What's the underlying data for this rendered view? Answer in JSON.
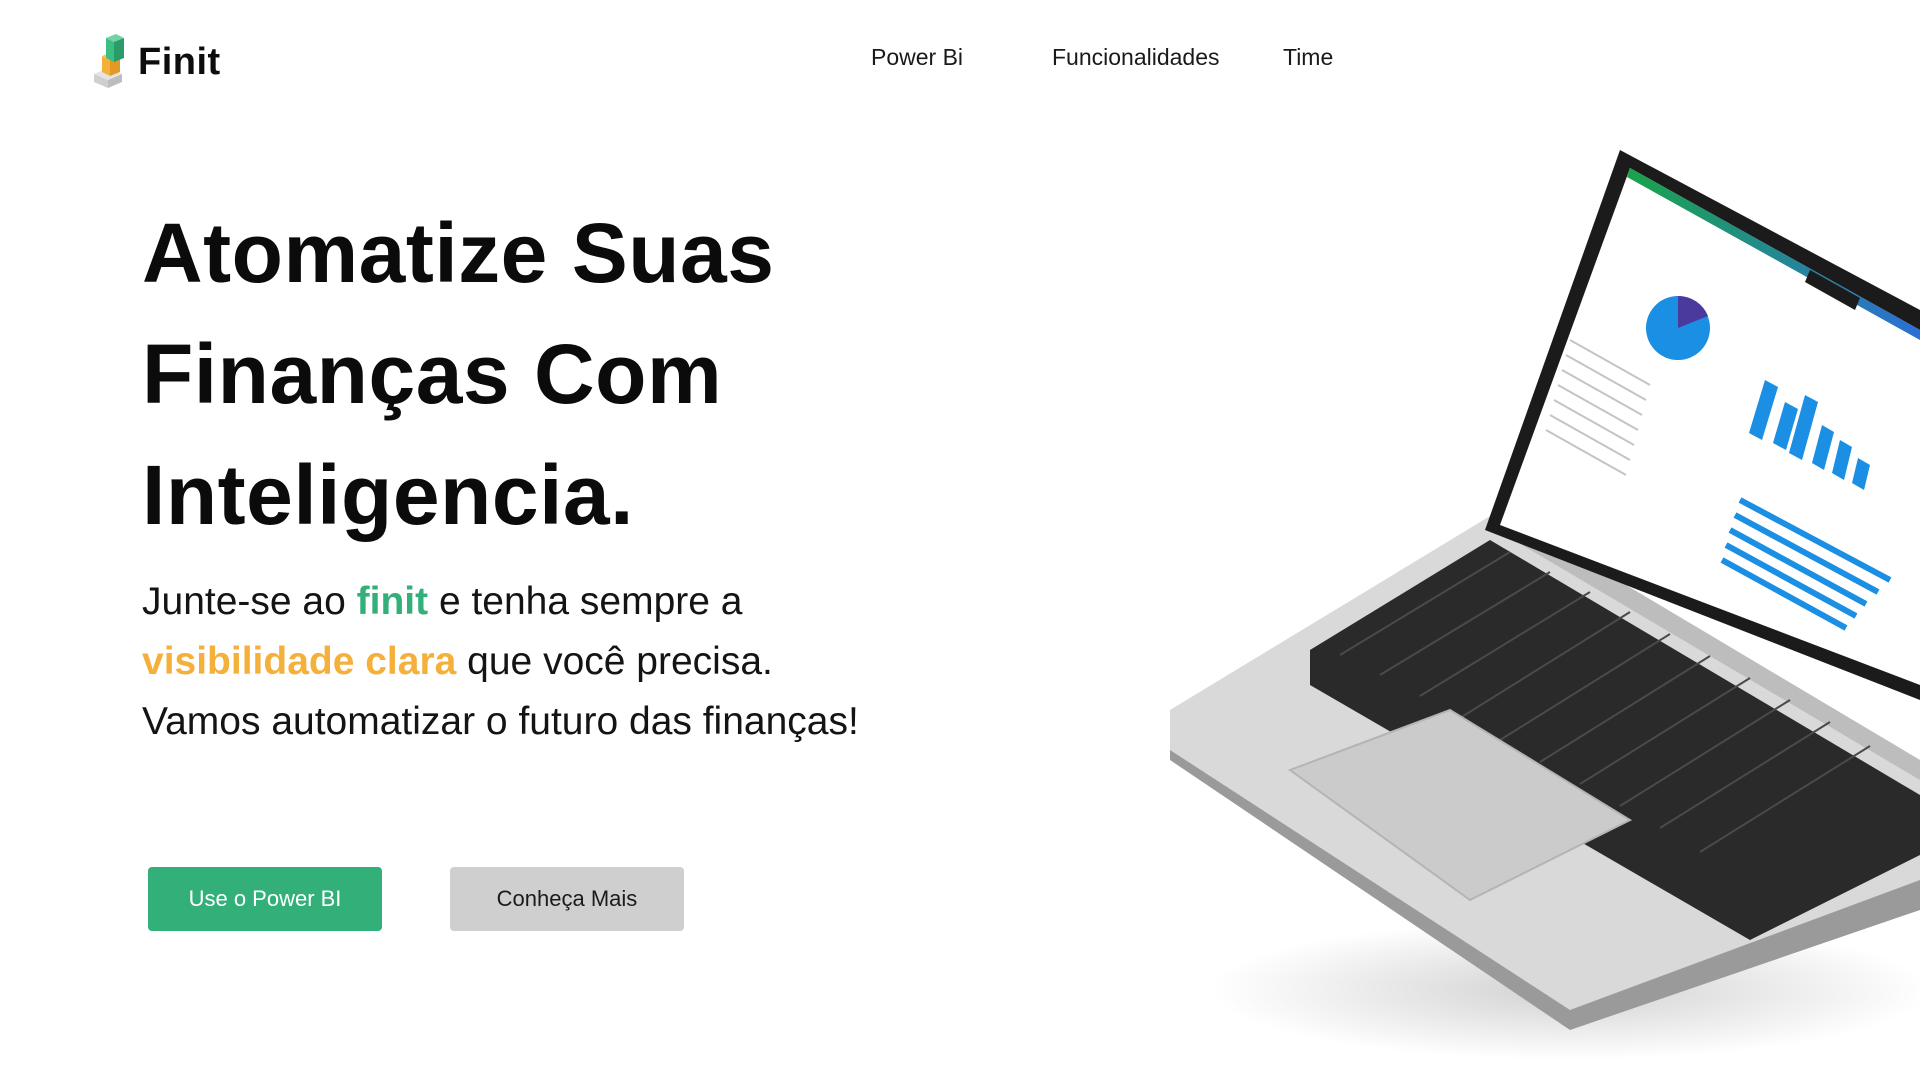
{
  "brand": {
    "name": "Finit"
  },
  "nav": {
    "items": [
      "Power Bi",
      "Funcionalidades",
      "Time"
    ]
  },
  "hero": {
    "headline_lines": [
      "Atomatize Suas",
      "Finanças Com",
      "Inteligencia."
    ],
    "sub": {
      "p1": "Junte-se ao ",
      "brand_word": "finit",
      "p2": " e tenha sempre a",
      "highlight": "visibilidade clara",
      "p3": " que você precisa.",
      "p4": "Vamos automatizar o futuro das finanças!"
    }
  },
  "buttons": {
    "primary": "Use o Power BI",
    "secondary": "Conheça Mais"
  },
  "colors": {
    "accent_green": "#33b07a",
    "accent_orange": "#f5b03c",
    "secondary_button": "#cfcfcf"
  },
  "icons": {
    "logo": "stacked-blocks-logo-icon",
    "laptop": "laptop-dashboard-illustration"
  }
}
